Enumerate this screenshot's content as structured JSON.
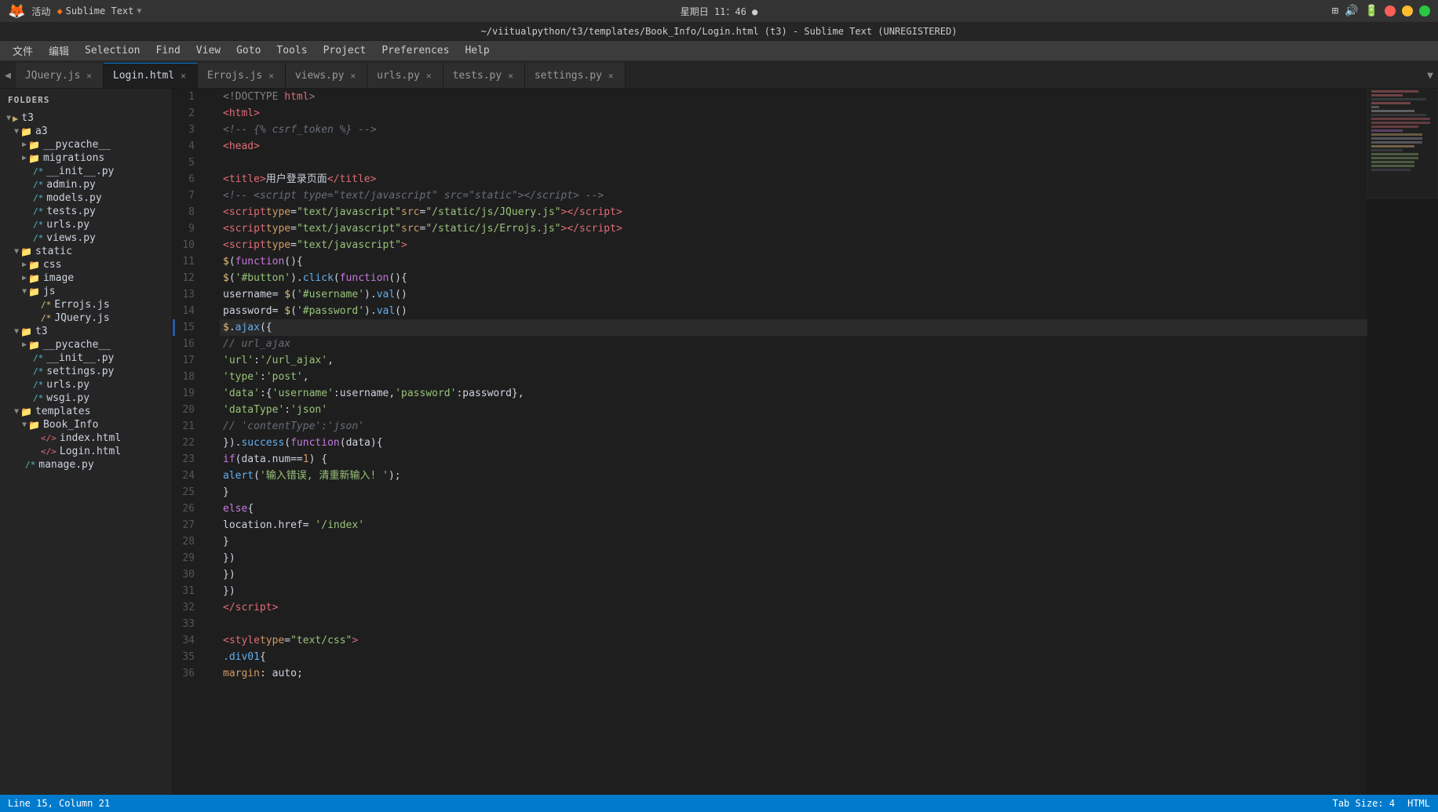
{
  "topbar": {
    "left": "活动",
    "app": "Sublime Text",
    "datetime": "星期日 11：46 ●",
    "filepath": "~/viitualpython/t3/templates/Book_Info/Login.html (t3) - Sublime Text (UNREGISTERED)"
  },
  "menu": {
    "items": [
      "文件",
      "编辑",
      "Selection",
      "Find",
      "View",
      "Goto",
      "Tools",
      "Project",
      "Preferences",
      "Help"
    ]
  },
  "tabs": [
    {
      "label": "JQuery.js",
      "active": false
    },
    {
      "label": "Login.html",
      "active": true
    },
    {
      "label": "Errojs.js",
      "active": false
    },
    {
      "label": "views.py",
      "active": false
    },
    {
      "label": "urls.py",
      "active": false
    },
    {
      "label": "tests.py",
      "active": false
    },
    {
      "label": "settings.py",
      "active": false
    }
  ],
  "sidebar": {
    "header": "FOLDERS",
    "tree": [
      {
        "indent": 1,
        "type": "folder",
        "label": "t3",
        "open": true
      },
      {
        "indent": 2,
        "type": "folder",
        "label": "a3",
        "open": true
      },
      {
        "indent": 3,
        "type": "folder",
        "label": "__pycache__",
        "open": false
      },
      {
        "indent": 3,
        "type": "folder",
        "label": "migrations",
        "open": false
      },
      {
        "indent": 3,
        "type": "file-py",
        "label": "__init__.py"
      },
      {
        "indent": 3,
        "type": "file-py",
        "label": "admin.py"
      },
      {
        "indent": 3,
        "type": "file-py",
        "label": "models.py"
      },
      {
        "indent": 3,
        "type": "file-py",
        "label": "tests.py"
      },
      {
        "indent": 3,
        "type": "file-py",
        "label": "urls.py"
      },
      {
        "indent": 3,
        "type": "file-py",
        "label": "views.py"
      },
      {
        "indent": 2,
        "type": "folder",
        "label": "static",
        "open": true
      },
      {
        "indent": 3,
        "type": "folder",
        "label": "css",
        "open": false
      },
      {
        "indent": 3,
        "type": "folder",
        "label": "image",
        "open": false
      },
      {
        "indent": 3,
        "type": "folder",
        "label": "js",
        "open": true
      },
      {
        "indent": 4,
        "type": "file-js",
        "label": "Errojs.js"
      },
      {
        "indent": 4,
        "type": "file-js",
        "label": "JQuery.js"
      },
      {
        "indent": 2,
        "type": "folder",
        "label": "t3",
        "open": true
      },
      {
        "indent": 3,
        "type": "folder",
        "label": "__pycache__",
        "open": false
      },
      {
        "indent": 3,
        "type": "file-py",
        "label": "__init__.py"
      },
      {
        "indent": 3,
        "type": "file-py",
        "label": "settings.py"
      },
      {
        "indent": 3,
        "type": "file-py",
        "label": "urls.py"
      },
      {
        "indent": 3,
        "type": "file-py",
        "label": "wsgi.py"
      },
      {
        "indent": 2,
        "type": "folder",
        "label": "templates",
        "open": true
      },
      {
        "indent": 3,
        "type": "folder",
        "label": "Book_Info",
        "open": true
      },
      {
        "indent": 4,
        "type": "file-html",
        "label": "index.html"
      },
      {
        "indent": 4,
        "type": "file-html",
        "label": "Login.html",
        "active": true
      },
      {
        "indent": 2,
        "type": "file-py",
        "label": "manage.py"
      }
    ]
  },
  "code": {
    "lines": [
      {
        "num": 1,
        "highlighted": false,
        "html": "<span class='c-doctype'>&lt;!DOCTYPE </span><span class='c-tag'>html</span><span class='c-doctype'>&gt;</span>"
      },
      {
        "num": 2,
        "highlighted": false,
        "html": "<span class='c-tag'>&lt;html&gt;</span>"
      },
      {
        "num": 3,
        "highlighted": false,
        "html": "<span class='c-comment'>&lt;!-- {% csrf_token %} --&gt;</span>"
      },
      {
        "num": 4,
        "highlighted": false,
        "html": "<span class='c-tag'>&lt;head&gt;</span>"
      },
      {
        "num": 5,
        "highlighted": false,
        "html": ""
      },
      {
        "num": 6,
        "highlighted": false,
        "html": "    <span class='c-tag'>&lt;title&gt;</span><span class='c-chinese'>用户登录页面</span><span class='c-tag'>&lt;/title&gt;</span>"
      },
      {
        "num": 7,
        "highlighted": false,
        "html": "<span class='c-comment'>&lt;!-- &lt;script type=\"text/javascript\" src=\"static\"&gt;&lt;/script&gt; --&gt;</span>"
      },
      {
        "num": 8,
        "highlighted": false,
        "html": "<span class='c-tag'>&lt;script</span> <span class='c-attr'>type</span><span class='c-punct'>=</span><span class='c-string'>\"text/javascript\"</span> <span class='c-attr'>src</span><span class='c-punct'>=</span><span class='c-string'>\"/static/js/JQuery.js\"</span><span class='c-tag'>&gt;&lt;/script&gt;</span>"
      },
      {
        "num": 9,
        "highlighted": false,
        "html": "<span class='c-tag'>&lt;script</span> <span class='c-attr'>type</span><span class='c-punct'>=</span><span class='c-string'>\"text/javascript\"</span> <span class='c-attr'>src</span><span class='c-punct'>=</span><span class='c-string'>\"/static/js/Errojs.js\"</span><span class='c-tag'>&gt;&lt;/script&gt;</span>"
      },
      {
        "num": 10,
        "highlighted": false,
        "html": "<span class='c-tag'>&lt;script</span> <span class='c-attr'>type</span><span class='c-punct'>=</span><span class='c-string'>\"text/javascript\"</span><span class='c-tag'>&gt;</span>"
      },
      {
        "num": 11,
        "highlighted": false,
        "html": "    <span class='c-dollar'>$</span><span class='c-punct'>(</span><span class='c-keyword'>function</span><span class='c-punct'>(){</span>"
      },
      {
        "num": 12,
        "highlighted": false,
        "html": "        <span class='c-dollar'>$</span><span class='c-punct'>(</span><span class='c-string'>'#button'</span><span class='c-punct'>).</span><span class='c-fn'>click</span><span class='c-punct'>(</span><span class='c-keyword'>function</span><span class='c-punct'>(){</span>"
      },
      {
        "num": 13,
        "highlighted": false,
        "html": "            <span class='c-text'>username</span> <span class='c-punct'>= </span><span class='c-dollar'>$</span><span class='c-punct'>(</span><span class='c-string'>'#username'</span><span class='c-punct'>).</span><span class='c-fn'>val</span><span class='c-punct'>()</span>"
      },
      {
        "num": 14,
        "highlighted": false,
        "html": "            <span class='c-text'>password</span> <span class='c-punct'>= </span><span class='c-dollar'>$</span><span class='c-punct'>(</span><span class='c-string'>'#password'</span><span class='c-punct'>).</span><span class='c-fn'>val</span><span class='c-punct'>()</span>"
      },
      {
        "num": 15,
        "highlighted": true,
        "html": "            <span class='c-dollar'>$</span><span class='c-punct'>.</span><span class='c-fn'>ajax</span><span class='c-punct'>({</span>"
      },
      {
        "num": 16,
        "highlighted": false,
        "html": "                <span class='c-comment'>// url_ajax</span>"
      },
      {
        "num": 17,
        "highlighted": false,
        "html": "                <span class='c-string'>'url'</span><span class='c-punct'>:</span><span class='c-string'>'/url_ajax'</span><span class='c-punct'>,</span>"
      },
      {
        "num": 18,
        "highlighted": false,
        "html": "                <span class='c-string'>'type'</span><span class='c-punct'>:</span><span class='c-string'>'post'</span><span class='c-punct'>,</span>"
      },
      {
        "num": 19,
        "highlighted": false,
        "html": "                <span class='c-string'>'data'</span><span class='c-punct'>:{</span><span class='c-string'>'username'</span><span class='c-punct'>:</span><span class='c-text'>username</span><span class='c-punct'>,</span><span class='c-string'>'password'</span><span class='c-punct'>:</span><span class='c-text'>password</span><span class='c-punct'>},</span>"
      },
      {
        "num": 20,
        "highlighted": false,
        "html": "                <span class='c-string'>'dataType'</span><span class='c-punct'>:</span><span class='c-string'>'json'</span>"
      },
      {
        "num": 21,
        "highlighted": false,
        "html": "                <span class='c-comment'>// 'contentType':'json'</span>"
      },
      {
        "num": 22,
        "highlighted": false,
        "html": "            <span class='c-punct'>}).</span><span class='c-fn'>success</span><span class='c-punct'>(</span><span class='c-keyword'>function</span><span class='c-punct'>(</span><span class='c-text'>data</span><span class='c-punct'>){</span>"
      },
      {
        "num": 23,
        "highlighted": false,
        "html": "                <span class='c-keyword'>if</span> <span class='c-punct'>(</span><span class='c-text'>data</span><span class='c-punct'>.</span><span class='c-text'>num</span><span class='c-punct'>==</span><span class='c-num'>1</span><span class='c-punct'>) {</span>"
      },
      {
        "num": 24,
        "highlighted": false,
        "html": "                    <span class='c-fn'>alert</span><span class='c-punct'>(</span><span class='c-string'>'输入错误, 清重新输入! '</span><span class='c-punct'>);</span>"
      },
      {
        "num": 25,
        "highlighted": false,
        "html": "                <span class='c-punct'>}</span>"
      },
      {
        "num": 26,
        "highlighted": false,
        "html": "                <span class='c-keyword'>else</span><span class='c-punct'>{</span>"
      },
      {
        "num": 27,
        "highlighted": false,
        "html": "                    <span class='c-text'>location</span><span class='c-punct'>.</span><span class='c-text'>href</span> <span class='c-punct'>= </span><span class='c-string'>'/index'</span>"
      },
      {
        "num": 28,
        "highlighted": false,
        "html": "                <span class='c-punct'>}</span>"
      },
      {
        "num": 29,
        "highlighted": false,
        "html": "            <span class='c-punct'>})</span>"
      },
      {
        "num": 30,
        "highlighted": false,
        "html": "        <span class='c-punct'>})</span>"
      },
      {
        "num": 31,
        "highlighted": false,
        "html": "    <span class='c-punct'>})</span>"
      },
      {
        "num": 32,
        "highlighted": false,
        "html": "<span class='c-tag'>&lt;/script&gt;</span>"
      },
      {
        "num": 33,
        "highlighted": false,
        "html": ""
      },
      {
        "num": 34,
        "highlighted": false,
        "html": "<span class='c-tag'>&lt;style</span> <span class='c-attr'>type</span><span class='c-punct'>=</span><span class='c-string'>\"text/css\"</span><span class='c-tag'>&gt;</span>"
      },
      {
        "num": 35,
        "highlighted": false,
        "html": "    <span class='c-fn'>.div01</span><span class='c-punct'>{</span>"
      },
      {
        "num": 36,
        "highlighted": false,
        "html": "        <span class='c-attr'>margin</span><span class='c-punct'>: </span><span class='c-text'>auto</span><span class='c-punct'>;</span>"
      }
    ]
  },
  "statusbar": {
    "left": "Line 15, Column 21",
    "right_tab": "Tab Size: 4",
    "right_type": "HTML"
  }
}
